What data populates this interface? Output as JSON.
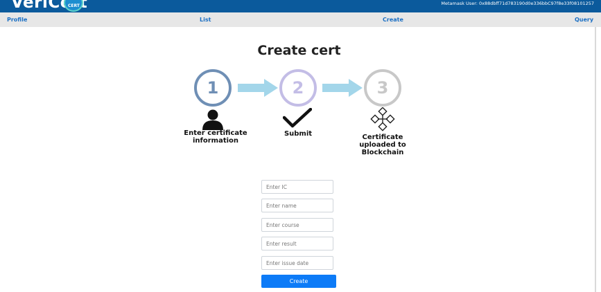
{
  "brand": {
    "name": "VeriCert",
    "badge": "CERT"
  },
  "metamask_user": "Metamask User: 0x88dbff71d783190d0e336bbC97f8e33f08101257",
  "nav": {
    "profile": "Profile",
    "list": "List",
    "create": "Create",
    "query": "Query"
  },
  "page_title": "Create cert",
  "steps": [
    {
      "number": "1",
      "label_lines": [
        "Enter certificate",
        "information"
      ],
      "icon": "person-icon",
      "color": "#6f8fb5"
    },
    {
      "number": "2",
      "label_lines": [
        "Submit"
      ],
      "icon": "checkmark-icon",
      "color": "#c3bde6"
    },
    {
      "number": "3",
      "label_lines": [
        "Certificate",
        "uploaded to",
        "Blockchain"
      ],
      "icon": "blockchain-cubes-icon",
      "color": "#c8c8c8"
    }
  ],
  "arrow_color": "#a3d6ea",
  "form": {
    "ic_placeholder": "Enter IC",
    "name_placeholder": "Enter name",
    "course_placeholder": "Enter course",
    "result_placeholder": "Enter result",
    "date_placeholder": "Enter issue date",
    "submit_label": "Create"
  },
  "colors": {
    "header": "#0b5a9c",
    "nav_bg": "#e7e7e7",
    "link": "#1a6fc4",
    "button": "#0d7bf7"
  }
}
